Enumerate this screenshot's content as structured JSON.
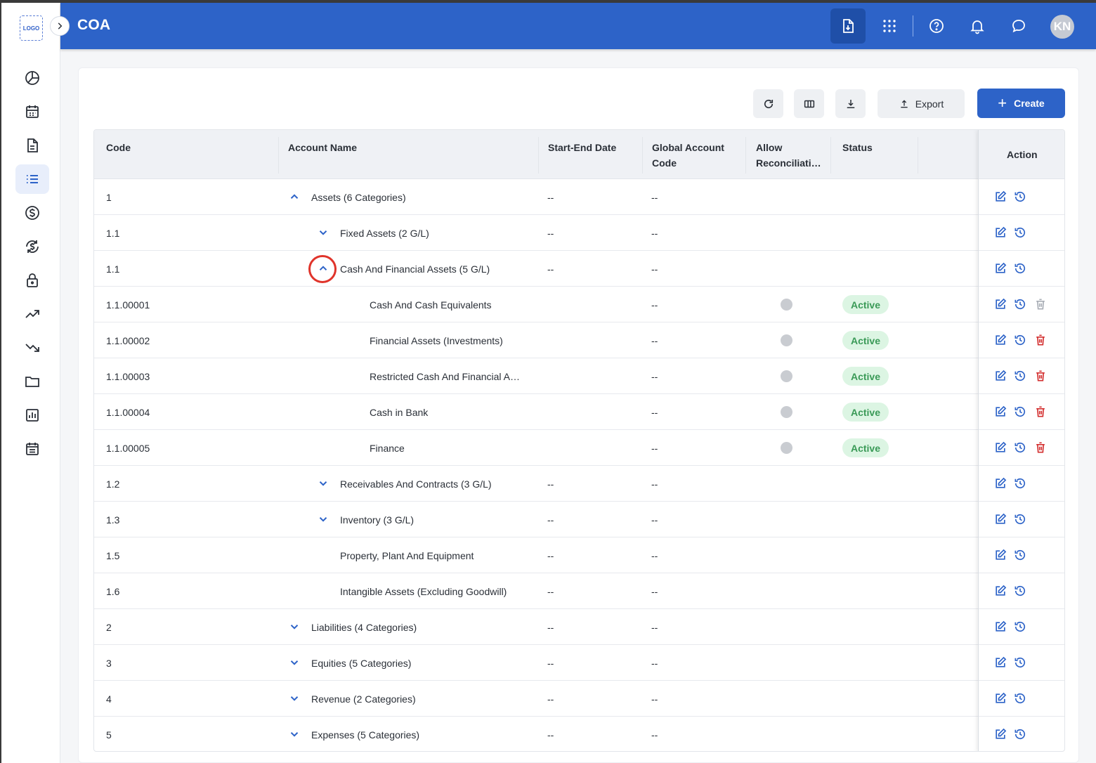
{
  "app": {
    "logo_text": "LOGO",
    "title": "COA",
    "avatar_initials": "KN"
  },
  "toolbar": {
    "export_label": "Export",
    "create_label": "Create"
  },
  "table": {
    "columns": {
      "code": "Code",
      "account_name": "Account Name",
      "start_end_date": "Start-End Date",
      "global_account_code_1": "Global Account",
      "global_account_code_2": "Code",
      "allow_reconciliation_1": "Allow",
      "allow_reconciliation_2": "Reconciliati…",
      "status": "Status",
      "action": "Action"
    },
    "rows": [
      {
        "code": "1",
        "name": "Assets (6 Categories)",
        "date": "--",
        "global": "--",
        "status": "",
        "level": 0,
        "chevron": "up"
      },
      {
        "code": "1.1",
        "name": "Fixed Assets (2 G/L)",
        "date": "--",
        "global": "--",
        "status": "",
        "level": 1,
        "chevron": "down"
      },
      {
        "code": "1.1",
        "name": "Cash And Financial Assets (5 G/L)",
        "date": "--",
        "global": "--",
        "status": "",
        "level": 1,
        "chevron": "up"
      },
      {
        "code": "1.1.00001",
        "name": "Cash And Cash Equivalents",
        "date": "",
        "global": "--",
        "status": "Active",
        "level": 2,
        "chevron": ""
      },
      {
        "code": "1.1.00002",
        "name": "Financial Assets (Investments)",
        "date": "",
        "global": "--",
        "status": "Active",
        "level": 2,
        "chevron": ""
      },
      {
        "code": "1.1.00003",
        "name": "Restricted Cash And Financial A…",
        "date": "",
        "global": "--",
        "status": "Active",
        "level": 2,
        "chevron": ""
      },
      {
        "code": "1.1.00004",
        "name": "Cash in Bank",
        "date": "",
        "global": "--",
        "status": "Active",
        "level": 2,
        "chevron": ""
      },
      {
        "code": "1.1.00005",
        "name": "Finance",
        "date": "",
        "global": "--",
        "status": "Active",
        "level": 2,
        "chevron": ""
      },
      {
        "code": "1.2",
        "name": "Receivables And Contracts (3 G/L)",
        "date": "--",
        "global": "--",
        "status": "",
        "level": 1,
        "chevron": "down"
      },
      {
        "code": "1.3",
        "name": "Inventory (3 G/L)",
        "date": "--",
        "global": "--",
        "status": "",
        "level": 1,
        "chevron": "down"
      },
      {
        "code": "1.5",
        "name": "Property, Plant And Equipment",
        "date": "--",
        "global": "--",
        "status": "",
        "level": 1,
        "chevron": ""
      },
      {
        "code": "1.6",
        "name": "Intangible Assets (Excluding Goodwill)",
        "date": "--",
        "global": "--",
        "status": "",
        "level": 1,
        "chevron": ""
      },
      {
        "code": "2",
        "name": "Liabilities (4 Categories)",
        "date": "--",
        "global": "--",
        "status": "",
        "level": 0,
        "chevron": "down"
      },
      {
        "code": "3",
        "name": "Equities (5 Categories)",
        "date": "--",
        "global": "--",
        "status": "",
        "level": 0,
        "chevron": "down"
      },
      {
        "code": "4",
        "name": "Revenue (2 Categories)",
        "date": "--",
        "global": "--",
        "status": "",
        "level": 0,
        "chevron": "down"
      },
      {
        "code": "5",
        "name": "Expenses (5 Categories)",
        "date": "--",
        "global": "--",
        "status": "",
        "level": 0,
        "chevron": "down"
      }
    ]
  },
  "colors": {
    "primary": "#2d63c8",
    "active_badge_bg": "#dcf5e3",
    "active_badge_text": "#3a9a57",
    "delete_red": "#d32f2f",
    "delete_disabled": "#a8adb5",
    "highlight_ring": "#e0342b"
  }
}
